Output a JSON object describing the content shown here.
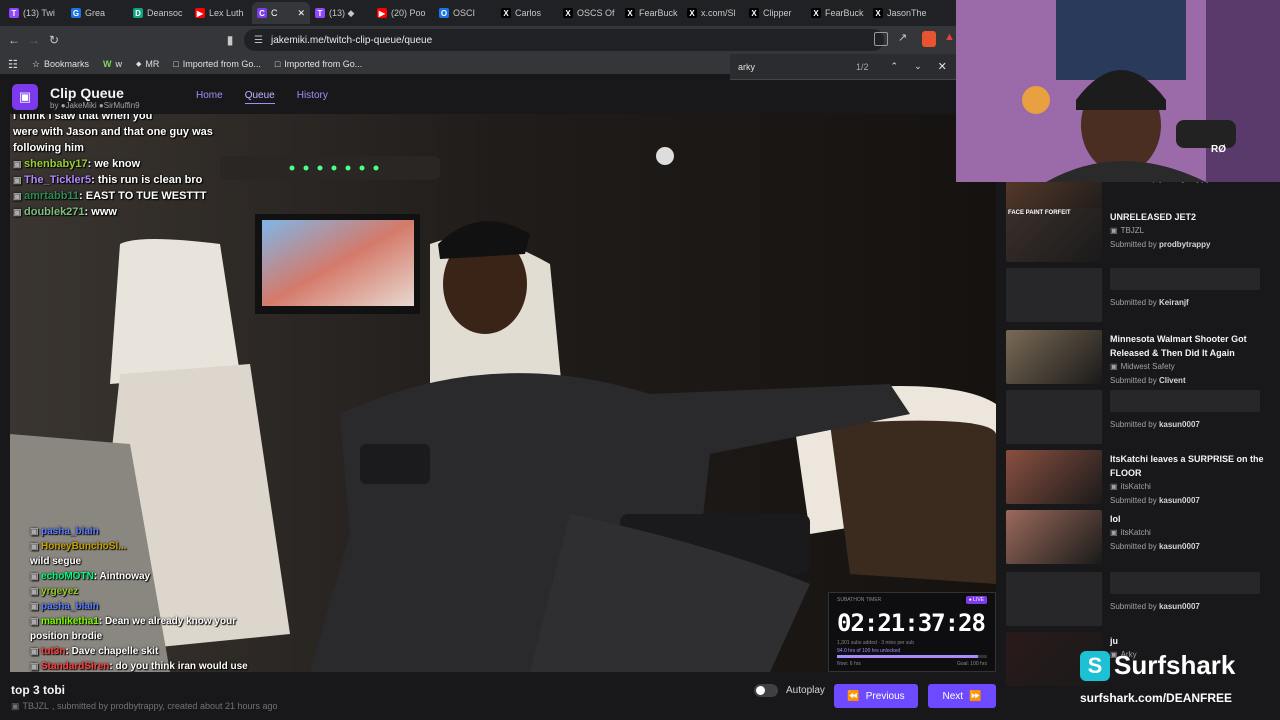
{
  "browser": {
    "tabs": [
      {
        "label": "(13) Twi",
        "color": "#9146ff",
        "glyph": "T"
      },
      {
        "label": "Grea",
        "color": "#1a73e8",
        "glyph": "G"
      },
      {
        "label": "Deansoc",
        "color": "#10a37f",
        "glyph": "D"
      },
      {
        "label": "Lex Luth",
        "color": "#ff0000",
        "glyph": "▶"
      },
      {
        "label": "C",
        "color": "#7c3aed",
        "glyph": "C",
        "active": true
      },
      {
        "label": "(13) ◆",
        "color": "#9146ff",
        "glyph": "T"
      },
      {
        "label": "(20) Poo",
        "color": "#ff0000",
        "glyph": "▶"
      },
      {
        "label": "OSCI",
        "color": "#1a73e8",
        "glyph": "O"
      },
      {
        "label": "Carlos",
        "color": "#000000",
        "glyph": "X"
      },
      {
        "label": "OSCS Of",
        "color": "#000000",
        "glyph": "X"
      },
      {
        "label": "FearBuck",
        "color": "#000000",
        "glyph": "X"
      },
      {
        "label": "x.com/Sl",
        "color": "#000000",
        "glyph": "X"
      },
      {
        "label": "Clipper",
        "color": "#000000",
        "glyph": "X"
      },
      {
        "label": "FearBuck",
        "color": "#000000",
        "glyph": "X"
      },
      {
        "label": "JasonThe",
        "color": "#000000",
        "glyph": "X"
      }
    ],
    "url": "jakemiki.me/twitch-clip-queue/queue",
    "bookmarks": [
      "Bookmarks",
      "w",
      "MR",
      "Imported from Go...",
      "Imported from Go..."
    ],
    "find": {
      "query": "arky",
      "count": "1/2"
    }
  },
  "app": {
    "title": "Clip Queue",
    "by_prefix": "by",
    "by_user1": "JakeMiki",
    "by_user2": "SirMuffin9",
    "nav": {
      "home": "Home",
      "queue": "Queue",
      "history": "History"
    }
  },
  "chat_top": [
    {
      "user": "",
      "color": "#ffffff",
      "msg": "I think I saw that when you"
    },
    {
      "user": "",
      "color": "#ffffff",
      "msg": "were with Jason and that one guy was"
    },
    {
      "user": "",
      "color": "#ffffff",
      "msg": "following him"
    },
    {
      "user": "shenbaby17",
      "color": "#9acd32",
      "msg": "we know"
    },
    {
      "user": "The_Tickler5",
      "color": "#b388ff",
      "msg": "this run is clean bro"
    },
    {
      "user": "amrtabb11",
      "color": "#2e8b57",
      "msg": "EAST TO TUE WESTTT"
    },
    {
      "user": "doublek271",
      "color": "#7fbf7f",
      "msg": "www"
    }
  ],
  "chat_bottom": [
    {
      "user": "pasha_blain",
      "color": "#5b7fff",
      "msg": ""
    },
    {
      "user": "HoneyBunchoSl...",
      "color": "#c8a400",
      "msg": ""
    },
    {
      "user": "",
      "color": "#ff4040",
      "msg": "wild segue"
    },
    {
      "user": "",
      "color": "#9146ff",
      "msg": ""
    },
    {
      "user": "",
      "color": "#2ecc71",
      "msg": ""
    },
    {
      "user": "echoMOTN",
      "color": "#00ff7f",
      "msg": "Aintnoway"
    },
    {
      "user": "yrgeyez",
      "color": "#9acd32",
      "msg": ""
    },
    {
      "user": "pasha_blain",
      "color": "#5b7fff",
      "msg": ""
    },
    {
      "user": "manliketha1",
      "color": "#7cfc00",
      "msg": "Dean we already know your position brodie"
    },
    {
      "user": "tut3n",
      "color": "#ff4040",
      "msg": "Dave chapelle skit"
    },
    {
      "user": "StandardSiren",
      "color": "#ff4040",
      "msg": "do you think iran would use nukes if they created them?"
    }
  ],
  "clip": {
    "title": "top 3 tobi",
    "meta_channel": "TBJZL",
    "meta_rest": ", submitted by prodbytrappy, created about 21 hours ago"
  },
  "timer": {
    "label": "SUBATHON TIMER",
    "live": "● LIVE",
    "value": "02:21:37:28",
    "line2": "1,301 subs added · 3 mins per sub",
    "line3": "94.0 hrs of 100 hrs unlocked",
    "goal": "Now: 6 hrs",
    "goal2": "Goal: 100 hrs",
    "progress": 0.94
  },
  "controls": {
    "autoplay": "Autoplay",
    "previous": "Previous",
    "next": "Next"
  },
  "queue": [
    {
      "title": "",
      "channel": "",
      "submitter": "prodbytrappy",
      "thumb": "#5a3a2a",
      "partial": true
    },
    {
      "title": "UNRELEASED JET2",
      "channel": "TBJZL",
      "submitter": "prodbytrappy",
      "thumb": "#3a2f2a",
      "overlay": "FACE PAINT FORFEIT"
    },
    {
      "title": "",
      "channel": "",
      "submitter": "Keiranjf",
      "thumb": "",
      "placeholder": true
    },
    {
      "title": "Minnesota Walmart Shooter Got Released & Then Did It Again",
      "channel": "Midwest Safety",
      "submitter": "Clivent",
      "thumb": "#7a6a55"
    },
    {
      "title": "",
      "channel": "",
      "submitter": "kasun0007",
      "thumb": "",
      "placeholder": true
    },
    {
      "title": "ItsKatchi leaves a SURPRISE on the FLOOR",
      "channel": "itsKatchi",
      "submitter": "kasun0007",
      "thumb": "#8a5040"
    },
    {
      "title": "lol",
      "channel": "itsKatchi",
      "submitter": "kasun0007",
      "thumb": "#9a6a5a"
    },
    {
      "title": "",
      "channel": "",
      "submitter": "kasun0007",
      "thumb": "",
      "placeholder": true
    },
    {
      "title": "ju",
      "channel": "Arky",
      "submitter": "",
      "thumb": "#2a1a1a"
    }
  ],
  "submitted_by": "Submitted by",
  "sponsor": {
    "name": "Surfshark",
    "url": "surfshark.com/DEANFREE"
  }
}
